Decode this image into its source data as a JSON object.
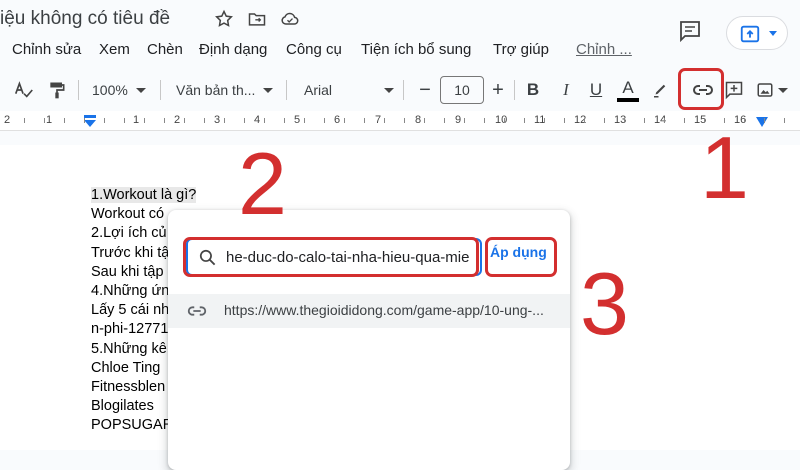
{
  "title": {
    "doc_name": "iệu không có tiêu đề",
    "star_icon": "star-icon",
    "move_icon": "move-to-folder-icon",
    "cloud_icon": "cloud-saved-icon",
    "comment_icon": "comment-icon",
    "share_icon": "share-upload-icon"
  },
  "menu": {
    "items": [
      "Chỉnh sửa",
      "Xem",
      "Chèn",
      "Định dạng",
      "Công cụ",
      "Tiện ích bổ sung",
      "Trợ giúp",
      "Chỉnh ..."
    ]
  },
  "toolbar": {
    "zoom": "100%",
    "style": "Văn bản th...",
    "font": "Arial",
    "font_size": "10",
    "minus": "−",
    "plus": "+",
    "bold": "B",
    "italic": "I",
    "underline": "U",
    "text_color": "A"
  },
  "ruler": {
    "numbers": [
      "2",
      "1",
      "1",
      "2",
      "3",
      "4",
      "5",
      "6",
      "7",
      "8",
      "9",
      "10",
      "11",
      "12",
      "13",
      "14",
      "15",
      "16"
    ]
  },
  "document": {
    "lines": [
      "1.Workout là gì?",
      "Workout có",
      "2.Lợi ích củ",
      "Trước khi tậ",
      "Sau khi tập",
      "4.Những ứn",
      "Lấy 5 cái nh",
      "n-phi-12771",
      "5.Những kê",
      "Chloe Ting",
      "Fitnessblen",
      "Blogilates",
      "POPSUGAR"
    ]
  },
  "link_popup": {
    "search_value": "he-duc-do-calo-tai-nha-hieu-qua-mie",
    "apply_label": "Áp dụng",
    "suggestion": "https://www.thegioididong.com/game-app/10-ung-..."
  },
  "annotations": {
    "step1": "1",
    "step2": "2",
    "step3": "3"
  },
  "colors": {
    "accent": "#1a73e8",
    "annotation_red": "#d32f2f"
  }
}
